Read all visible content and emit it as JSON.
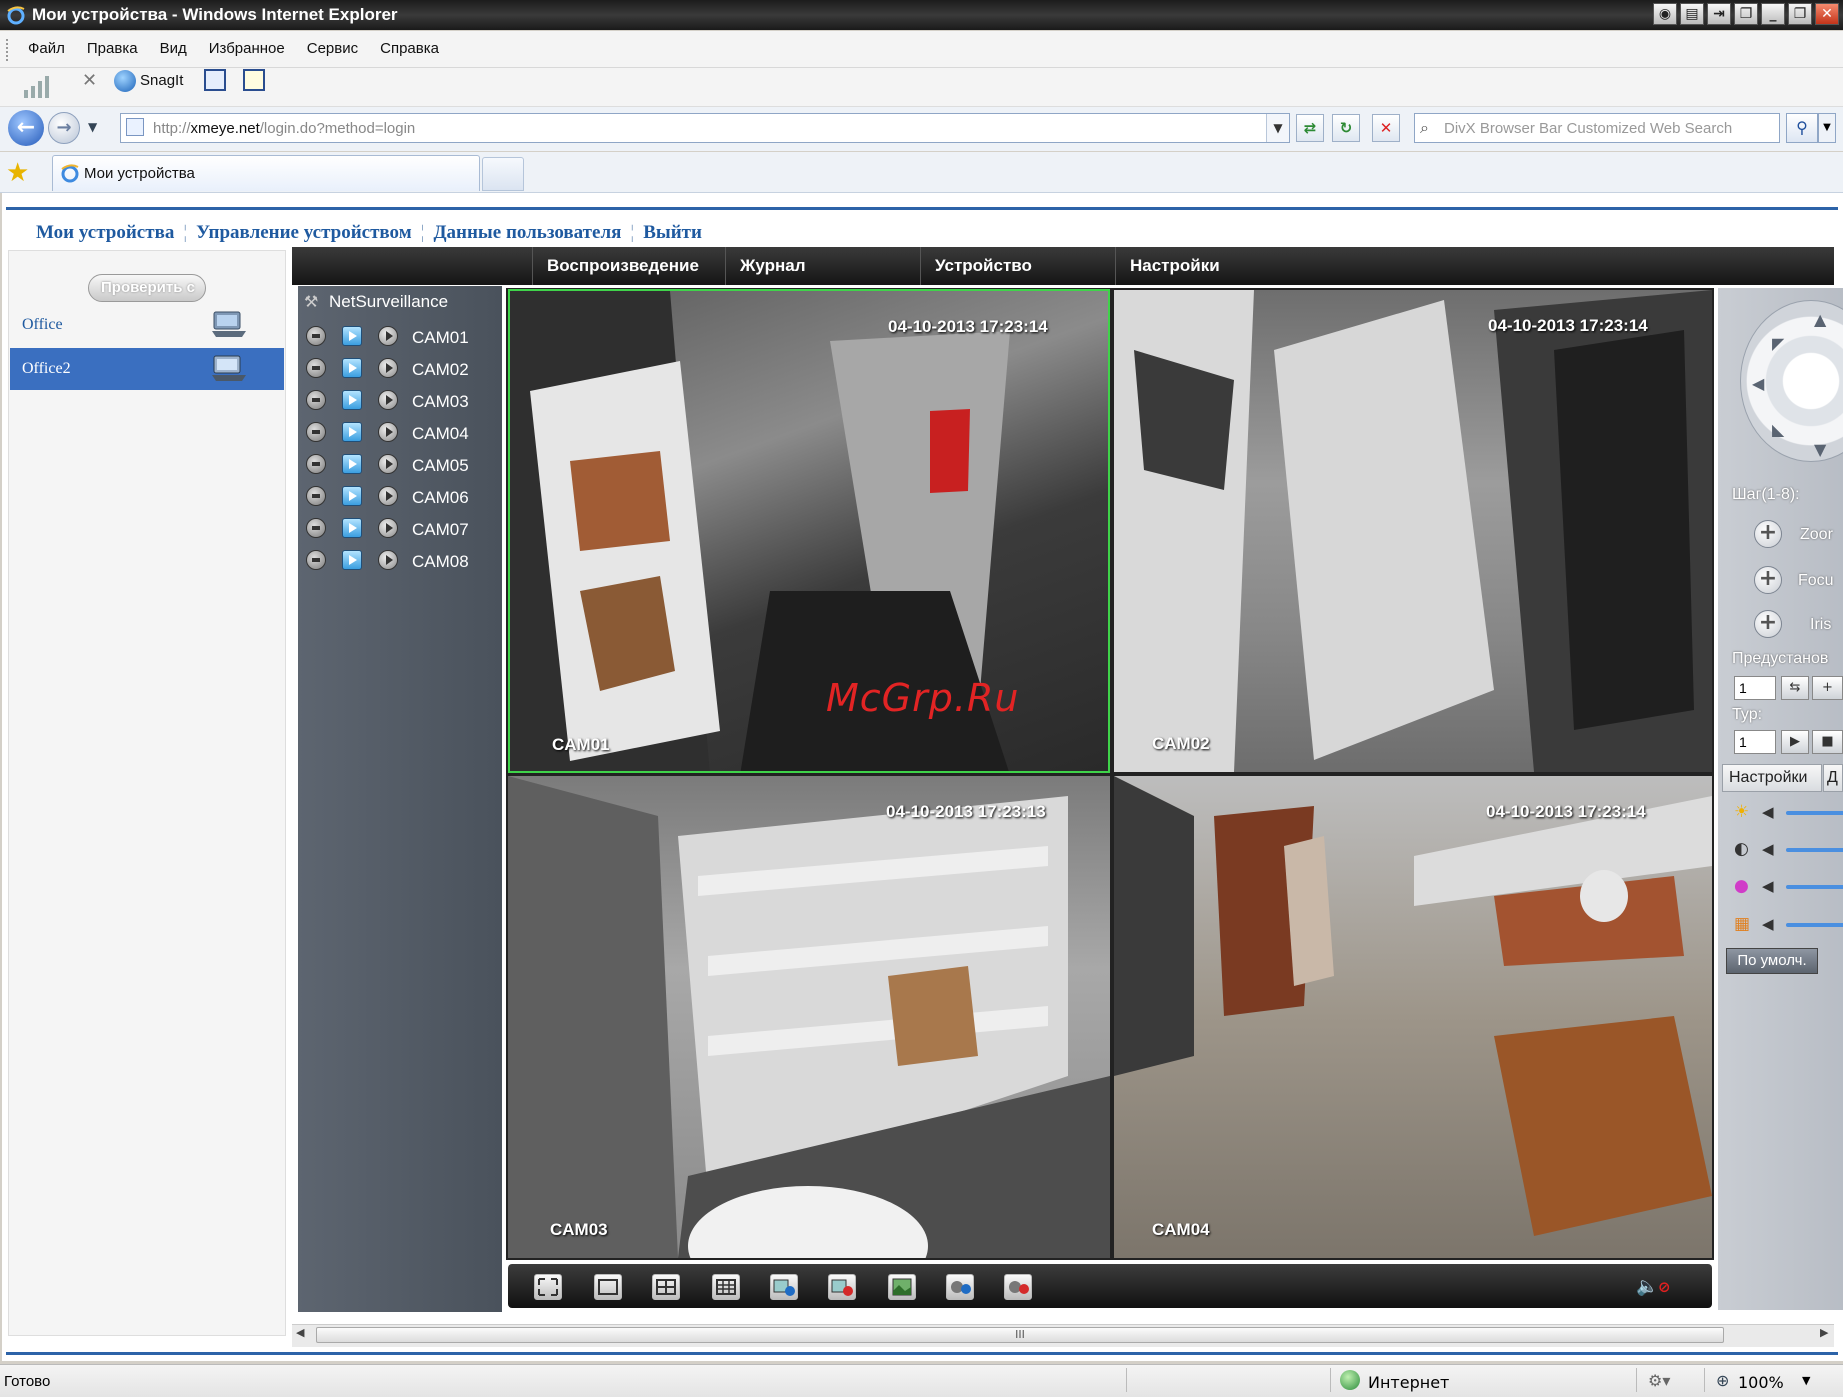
{
  "window": {
    "title": "Мои устройства - Windows Internet Explorer"
  },
  "menu": {
    "items": [
      "Файл",
      "Правка",
      "Вид",
      "Избранное",
      "Сервис",
      "Справка"
    ]
  },
  "toolbar": {
    "snagit_label": "SnagIt"
  },
  "address": {
    "url_prefix": "http://",
    "url_host": "xmeye.net",
    "url_path": "/login.do?method=login",
    "search_placeholder": "DivX Browser Bar Customized Web Search"
  },
  "tab": {
    "label": "Мои устройства"
  },
  "topnav": {
    "items": [
      "Мои устройства",
      "Управление устройством",
      "Данные пользователя",
      "Выйти"
    ]
  },
  "left": {
    "check_button": "Проверить с",
    "devices": [
      {
        "name": "Office",
        "selected": false
      },
      {
        "name": "Office2",
        "selected": true
      }
    ]
  },
  "main_tabs": [
    "Воспроизведение",
    "Журнал",
    "Устройство",
    "Настройки"
  ],
  "tree": {
    "root": "NetSurveillance",
    "cameras": [
      "CAM01",
      "CAM02",
      "CAM03",
      "CAM04",
      "CAM05",
      "CAM06",
      "CAM07",
      "CAM08"
    ]
  },
  "videos": [
    {
      "name": "CAM01",
      "timestamp": "04-10-2013 17:23:14"
    },
    {
      "name": "CAM02",
      "timestamp": "04-10-2013 17:23:14"
    },
    {
      "name": "CAM03",
      "timestamp": "04-10-2013 17:23:13"
    },
    {
      "name": "CAM04",
      "timestamp": "04-10-2013 17:23:14"
    }
  ],
  "watermark": "McGrp.Ru",
  "ptz": {
    "step_label": "Шаг(1-8):",
    "zoom_label": "Zoor",
    "focus_label": "Focu",
    "iris_label": "Iris",
    "preset_label": "Предустанов",
    "preset_value": "1",
    "tour_label": "Тур:",
    "tour_value": "1",
    "settings_tab": "Настройки",
    "settings_tab2": "Д",
    "default_button": "По умолч."
  },
  "scroll": {
    "thumb_glyph": "III"
  },
  "status": {
    "ready": "Готово",
    "zone": "Интернет",
    "zoom": "100%"
  },
  "colors": {
    "accent": "#2d63a8",
    "link": "#1f5aa0",
    "selected": "#3a6fc0",
    "active_frame": "#3fd34a"
  }
}
